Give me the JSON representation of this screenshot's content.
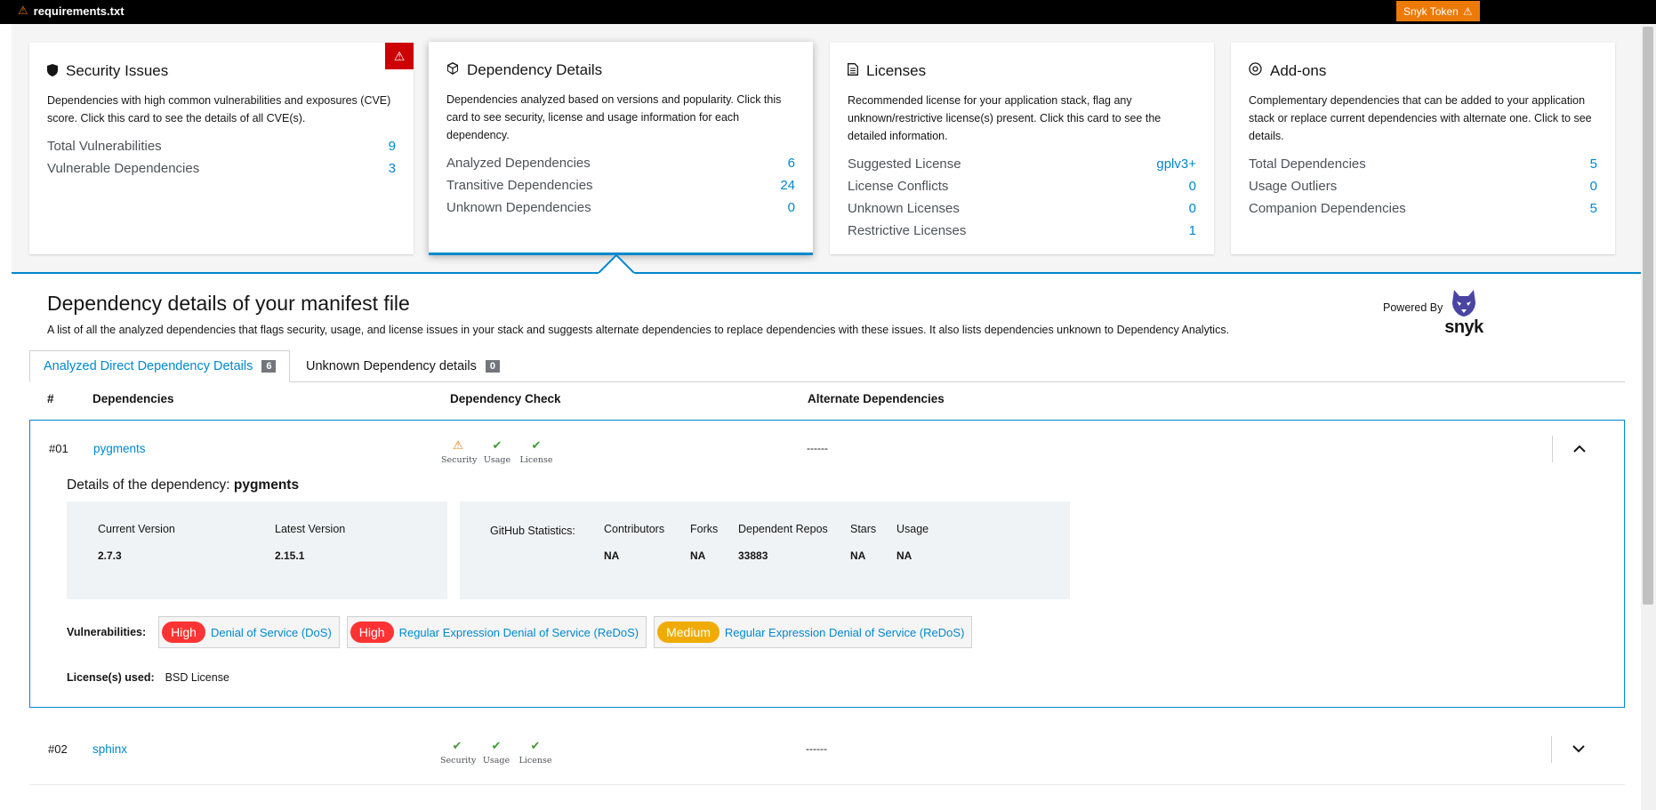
{
  "topbar": {
    "file": "requirements.txt",
    "snyk_token": "Snyk Token"
  },
  "cards": {
    "security": {
      "title": "Security Issues",
      "desc": "Dependencies with high common vulnerabilities and exposures (CVE) score. Click this card to see the details of all CVE(s).",
      "rows": [
        {
          "label": "Total Vulnerabilities",
          "value": "9"
        },
        {
          "label": "Vulnerable Dependencies",
          "value": "3"
        }
      ]
    },
    "dependency": {
      "title": "Dependency Details",
      "desc": "Dependencies analyzed based on versions and popularity. Click this card to see security, license and usage information for each dependency.",
      "rows": [
        {
          "label": "Analyzed Dependencies",
          "value": "6"
        },
        {
          "label": "Transitive Dependencies",
          "value": "24"
        },
        {
          "label": "Unknown Dependencies",
          "value": "0"
        }
      ]
    },
    "licenses": {
      "title": "Licenses",
      "desc": "Recommended license for your application stack, flag any unknown/restrictive license(s) present. Click this card to see the detailed information.",
      "rows": [
        {
          "label": "Suggested License",
          "value": "gplv3+"
        },
        {
          "label": "License Conflicts",
          "value": "0"
        },
        {
          "label": "Unknown Licenses",
          "value": "0"
        },
        {
          "label": "Restrictive Licenses",
          "value": "1"
        }
      ]
    },
    "addons": {
      "title": "Add-ons",
      "desc": "Complementary dependencies that can be added to your application stack or replace current dependencies with alternate one. Click to see details.",
      "rows": [
        {
          "label": "Total Dependencies",
          "value": "5"
        },
        {
          "label": "Usage Outliers",
          "value": "0"
        },
        {
          "label": "Companion Dependencies",
          "value": "5"
        }
      ]
    }
  },
  "header": {
    "title": "Dependency details of your manifest file",
    "desc": "A list of all the analyzed dependencies that flags security, usage, and license issues in your stack and suggests alternate dependencies to replace dependencies with these issues. It also lists dependencies unknown to Dependency Analytics.",
    "powered_by": "Powered By",
    "logo_text": "snyk"
  },
  "tabs": [
    {
      "label": "Analyzed Direct Dependency Details",
      "count": "6"
    },
    {
      "label": "Unknown Dependency details",
      "count": "0"
    }
  ],
  "columns": {
    "num": "#",
    "deps": "Dependencies",
    "check": "Dependency Check",
    "alt": "Alternate Dependencies"
  },
  "check_labels": {
    "security": "Security",
    "usage": "Usage",
    "license": "License"
  },
  "rows": [
    {
      "num": "#01",
      "name": "pygments",
      "alt": "------",
      "details": {
        "title_prefix": "Details of the dependency:",
        "name": "pygments",
        "current_version_label": "Current Version",
        "current_version": "2.7.3",
        "latest_version_label": "Latest Version",
        "latest_version": "2.15.1",
        "github_label": "GitHub Statistics:",
        "github": [
          {
            "label": "Contributors",
            "value": "NA"
          },
          {
            "label": "Forks",
            "value": "NA"
          },
          {
            "label": "Dependent Repos",
            "value": "33883"
          },
          {
            "label": "Stars",
            "value": "NA"
          },
          {
            "label": "Usage",
            "value": "NA"
          }
        ],
        "vuln_label": "Vulnerabilities:",
        "vulns": [
          {
            "severity": "High",
            "name": "Denial of Service (DoS)"
          },
          {
            "severity": "High",
            "name": "Regular Expression Denial of Service (ReDoS)"
          },
          {
            "severity": "Medium",
            "name": "Regular Expression Denial of Service (ReDoS)"
          }
        ],
        "license_label": "License(s) used:",
        "license": "BSD License"
      }
    },
    {
      "num": "#02",
      "name": "sphinx",
      "alt": "------"
    }
  ],
  "colors": {
    "accent": "#0088ce",
    "danger": "#cc0000",
    "warning": "#ec7a08",
    "ok": "#3f9c35",
    "high": "#ff3333",
    "medium": "#f0ab00"
  }
}
